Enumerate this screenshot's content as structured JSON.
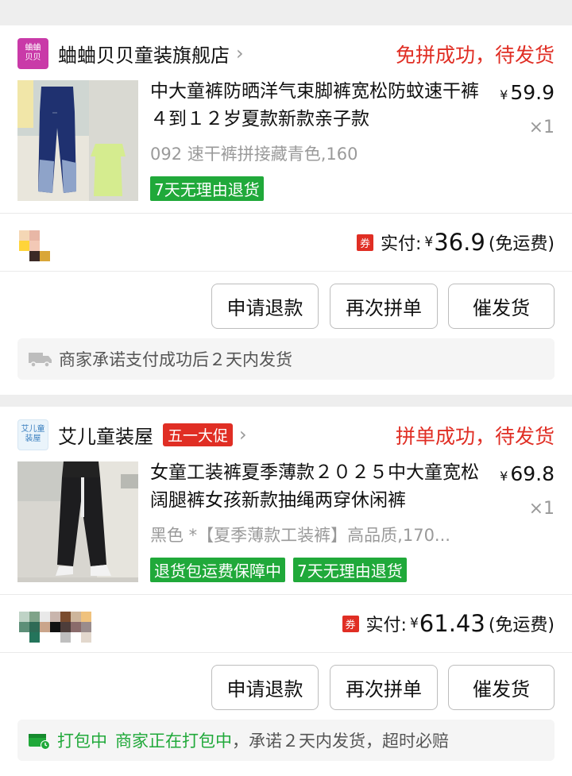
{
  "orders": [
    {
      "shop": {
        "logo_text_line1": "蛐蛐",
        "logo_text_line2": "贝贝",
        "name": "蛐蛐贝贝童装旗舰店",
        "promo": ""
      },
      "status": "免拼成功，待发货",
      "product": {
        "title": "中大童裤防晒洋气束脚裤宽松防蚊速干裤４到１２岁夏款新款亲子款",
        "price": "59.9",
        "currency": "¥",
        "qty": "×1",
        "spec": "092 速干裤拼接藏青色,160",
        "tags": [
          "7天无理由退货"
        ]
      },
      "payment": {
        "coupon": "券",
        "label": "实付:",
        "currency": "¥",
        "amount": "36.9",
        "shipping": "(免运费)"
      },
      "buttons": {
        "refund": "申请退款",
        "rebuy": "再次拼单",
        "urge": "催发货"
      },
      "notice": {
        "icon": "truck-icon",
        "text": "商家承诺支付成功后２天内发货"
      }
    },
    {
      "shop": {
        "logo_text_line1": "艾儿童",
        "logo_text_line2": "装屋",
        "name": "艾儿童装屋",
        "promo": "五一大促"
      },
      "status": "拼单成功，待发货",
      "product": {
        "title": "女童工装裤夏季薄款２０２５中大童宽松阔腿裤女孩新款抽绳两穿休闲裤",
        "price": "69.8",
        "currency": "¥",
        "qty": "×1",
        "spec": "黑色 *【夏季薄款工装裤】高品质,170...",
        "tags": [
          "退货包运费保障中",
          "7天无理由退货"
        ]
      },
      "payment": {
        "coupon": "券",
        "label": "实付:",
        "currency": "¥",
        "amount": "61.43",
        "shipping": "(免运费)"
      },
      "buttons": {
        "refund": "申请退款",
        "rebuy": "再次拼单",
        "urge": "催发货"
      },
      "notice": {
        "icon": "packing-truck-icon",
        "status": "打包中",
        "detail": "商家正在打包中",
        "rest": "，承诺２天内发货，超时必赔"
      }
    }
  ],
  "colors": {
    "accent_red": "#e02e24",
    "tag_green": "#20a93a",
    "background": "#eeeeee"
  }
}
